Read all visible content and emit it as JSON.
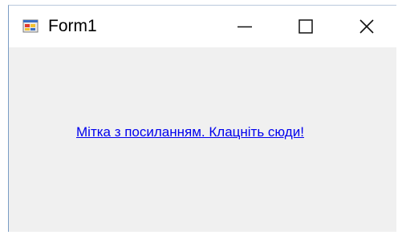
{
  "window": {
    "title": "Form1",
    "icon": "winforms-app-icon",
    "controls": [
      "minimize-icon",
      "maximize-icon",
      "close-icon"
    ]
  },
  "form": {
    "link_label": "Мітка з посиланням. Клацніть сюди!",
    "link_color": "#0000ee",
    "background_color": "#f0f0f0"
  }
}
